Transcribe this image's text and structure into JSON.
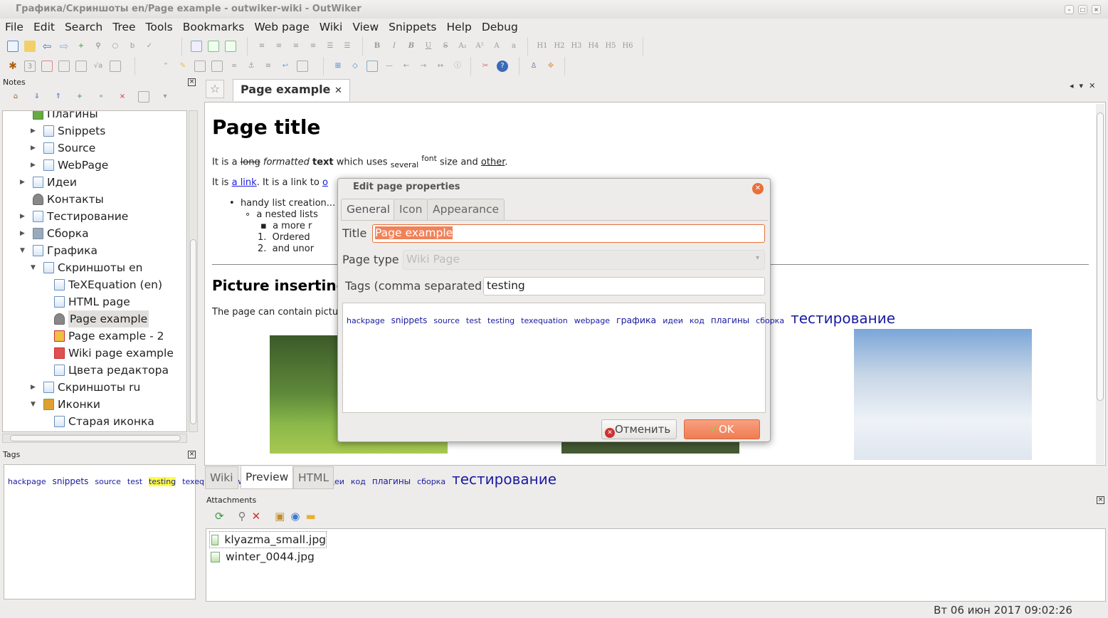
{
  "window": {
    "title": "Графика/Скриншоты en/Page example - outwiker-wiki - OutWiker"
  },
  "menu": [
    "File",
    "Edit",
    "Search",
    "Tree",
    "Tools",
    "Bookmarks",
    "Web page",
    "Wiki",
    "View",
    "Snippets",
    "Help",
    "Debug"
  ],
  "toolbar": {
    "headings": [
      "H1",
      "H2",
      "H3",
      "H4",
      "H5",
      "H6"
    ]
  },
  "notes": {
    "title": "Notes",
    "tree": [
      {
        "label": "Плагины",
        "level": 1,
        "icon": "folder-plugin-icon",
        "expander": false
      },
      {
        "label": "Snippets",
        "level": 2,
        "icon": "page-icon",
        "expander": true
      },
      {
        "label": "Source",
        "level": 2,
        "icon": "page-icon",
        "expander": true
      },
      {
        "label": "WebPage",
        "level": 2,
        "icon": "page-icon",
        "expander": true
      },
      {
        "label": "Идеи",
        "level": 1,
        "icon": "page-icon",
        "expander": true
      },
      {
        "label": "Контакты",
        "level": 1,
        "icon": "person-icon",
        "expander": false
      },
      {
        "label": "Тестирование",
        "level": 1,
        "icon": "page-icon",
        "expander": true
      },
      {
        "label": "Сборка",
        "level": 1,
        "icon": "wrench-icon",
        "expander": true
      },
      {
        "label": "Графика",
        "level": 1,
        "icon": "page-icon",
        "expander": "open"
      },
      {
        "label": "Скриншоты en",
        "level": 2,
        "icon": "page-icon",
        "expander": "open"
      },
      {
        "label": "TeXEquation (en)",
        "level": 3,
        "icon": "page-icon",
        "expander": false
      },
      {
        "label": "HTML page",
        "level": 3,
        "icon": "page-icon",
        "expander": false
      },
      {
        "label": "Page example",
        "level": 3,
        "icon": "person-icon",
        "expander": false,
        "selected": true
      },
      {
        "label": "Page example - 2",
        "level": 3,
        "icon": "warning-icon",
        "expander": false
      },
      {
        "label": "Wiki page example",
        "level": 3,
        "icon": "flag-icon",
        "expander": false
      },
      {
        "label": "Цвета редактора",
        "level": 3,
        "icon": "page-icon",
        "expander": false
      },
      {
        "label": "Скриншоты ru",
        "level": 2,
        "icon": "page-icon",
        "expander": true
      },
      {
        "label": "Иконки",
        "level": 2,
        "icon": "paint-icon",
        "expander": "open"
      },
      {
        "label": "Старая иконка",
        "level": 3,
        "icon": "page-icon",
        "expander": false
      }
    ]
  },
  "tags_panel": {
    "title": "Tags",
    "tags": [
      {
        "t": "hackpage",
        "s": 11
      },
      {
        "t": "snippets",
        "s": 12
      },
      {
        "t": "source",
        "s": 11
      },
      {
        "t": "test",
        "s": 11
      },
      {
        "t": "testing",
        "s": 11,
        "hl": true
      },
      {
        "t": "texequation",
        "s": 11
      },
      {
        "t": "webpage",
        "s": 11
      },
      {
        "t": "графика",
        "s": 12.5
      },
      {
        "t": "идеи",
        "s": 11
      },
      {
        "t": "код",
        "s": 11
      },
      {
        "t": "плагины",
        "s": 12
      },
      {
        "t": "сборка",
        "s": 11
      },
      {
        "t": "тестирование",
        "s": 20
      }
    ]
  },
  "editor": {
    "tab": "Page example",
    "bottom_tabs": [
      "Wiki",
      "Preview",
      "HTML"
    ],
    "active_bottom_tab": "Preview",
    "content": {
      "h1": "Page title",
      "p1": [
        "It is a ",
        "long",
        " ",
        "formatted",
        " ",
        "text",
        " which uses ",
        "several",
        "font",
        " size and ",
        "other",
        "."
      ],
      "p2": [
        "It is ",
        "a link",
        ". It is a link to ",
        "o"
      ],
      "list": [
        "handy list creation...",
        "a nested lists",
        "a more r",
        "Ordered",
        "and unor"
      ],
      "h2": "Picture inserting",
      "p3": "The page can contain pictu"
    }
  },
  "dialog": {
    "title": "Edit page properties",
    "tabs": [
      "General",
      "Icon",
      "Appearance"
    ],
    "active_tab": "General",
    "title_label": "Title",
    "title_value": "Page example",
    "page_type_label": "Page type",
    "page_type_value": "Wiki Page",
    "tags_label": "Tags (comma separated)",
    "tags_value": "testing",
    "tag_cloud": [
      {
        "t": "hackpage",
        "s": 11
      },
      {
        "t": "snippets",
        "s": 12
      },
      {
        "t": "source",
        "s": 11
      },
      {
        "t": "test",
        "s": 11
      },
      {
        "t": "testing",
        "s": 11
      },
      {
        "t": "texequation",
        "s": 11
      },
      {
        "t": "webpage",
        "s": 11
      },
      {
        "t": "графика",
        "s": 12.5
      },
      {
        "t": "идеи",
        "s": 11
      },
      {
        "t": "код",
        "s": 11
      },
      {
        "t": "плагины",
        "s": 12
      },
      {
        "t": "сборка",
        "s": 11
      },
      {
        "t": "тестирование",
        "s": 20
      }
    ],
    "cancel": "Отменить",
    "ok": "OK"
  },
  "attachments": {
    "title": "Attachments",
    "files": [
      "klyazma_small.jpg",
      "winter_0044.jpg"
    ]
  },
  "status": {
    "datetime": "Вт 06 июн 2017 09:02:26"
  },
  "colors": {
    "accent": "#f0825a",
    "link": "#1a1ae0",
    "tag": "#1a1aa0",
    "highlight": "#ffff40"
  }
}
